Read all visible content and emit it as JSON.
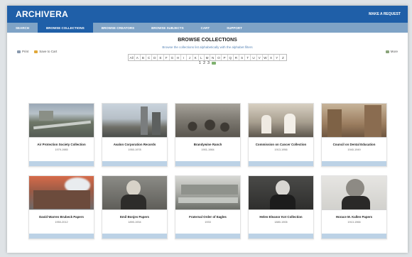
{
  "header": {
    "brand": "ARCHIVERA",
    "action": "MAKE A REQUEST"
  },
  "nav": {
    "items": [
      {
        "label": "SEARCH",
        "active": false
      },
      {
        "label": "BROWSE COLLECTIONS",
        "active": true
      },
      {
        "label": "BROWSE CREATORS",
        "active": false
      },
      {
        "label": "BROWSE SUBJECTS",
        "active": false
      },
      {
        "label": "CART",
        "active": false
      },
      {
        "label": "SUPPORT",
        "active": false
      }
    ]
  },
  "main": {
    "title": "BROWSE COLLECTIONS",
    "subtitle": "Browse the collections list alphabetically with the alphabet filters",
    "alphabet": [
      "All",
      "A",
      "B",
      "C",
      "D",
      "E",
      "F",
      "G",
      "H",
      "I",
      "J",
      "K",
      "L",
      "M",
      "N",
      "O",
      "P",
      "Q",
      "R",
      "S",
      "T",
      "U",
      "V",
      "W",
      "X",
      "Y",
      "Z"
    ],
    "tools": {
      "print": "Print",
      "save": "Save to Cart",
      "more": "More"
    },
    "pagination": {
      "pages": [
        "1",
        "2",
        "3"
      ]
    },
    "collections": [
      {
        "title": "Air Protection Society Collection",
        "dates": "1979-1985"
      },
      {
        "title": "Avalon Corporation Records",
        "dates": "1950-1978"
      },
      {
        "title": "Brandywine Ranch",
        "dates": "1901-1984"
      },
      {
        "title": "Commission on Cancer Collection",
        "dates": "1913-1956"
      },
      {
        "title": "Council on Dental Education",
        "dates": "1940-1949"
      },
      {
        "title": "David Warren Brubeck Papers",
        "dates": "1950-2012"
      },
      {
        "title": "Emil Bonjes Papers",
        "dates": "1890-1934"
      },
      {
        "title": "Fraternal Order of Eagles",
        "dates": "1933"
      },
      {
        "title": "Helen Eleanor Kot Collection",
        "dates": "1880-1906"
      },
      {
        "title": "Horace M. Kallen Papers",
        "dates": "1913-1966"
      }
    ]
  },
  "colors": {
    "header": "#1f5fa8",
    "nav": "#7fa3c6",
    "nav_active": "#1f5fa8",
    "card_footer": "#bcd2e6",
    "subtitle": "#5b87b8"
  }
}
